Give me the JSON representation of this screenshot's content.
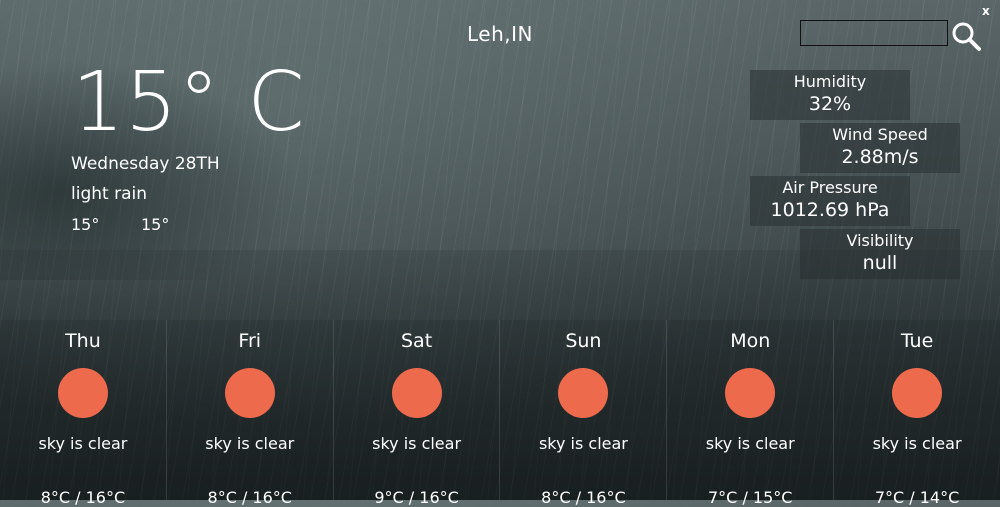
{
  "app": {
    "city": "Leh,IN",
    "search_placeholder": "",
    "close_label": "x"
  },
  "current": {
    "temperature": "15° C",
    "date": "Wednesday 28TH",
    "description": "light rain",
    "temp_min": "15°",
    "temp_max": "15°"
  },
  "stats": {
    "humidity": {
      "label": "Humidity",
      "value": "32%"
    },
    "wind_speed": {
      "label": "Wind Speed",
      "value": "2.88m/s"
    },
    "air_pressure": {
      "label": "Air Pressure",
      "value": "1012.69 hPa"
    },
    "visibility": {
      "label": "Visibility",
      "value": "null"
    }
  },
  "forecast": [
    {
      "day": "Thu",
      "condition": "sky is clear",
      "range": "8°C / 16°C",
      "icon": "sun-icon"
    },
    {
      "day": "Fri",
      "condition": "sky is clear",
      "range": "8°C / 16°C",
      "icon": "sun-icon"
    },
    {
      "day": "Sat",
      "condition": "sky is clear",
      "range": "9°C / 16°C",
      "icon": "sun-icon"
    },
    {
      "day": "Sun",
      "condition": "sky is clear",
      "range": "8°C / 16°C",
      "icon": "sun-icon"
    },
    {
      "day": "Mon",
      "condition": "sky is clear",
      "range": "7°C / 15°C",
      "icon": "sun-icon"
    },
    {
      "day": "Tue",
      "condition": "sky is clear",
      "range": "7°C / 14°C",
      "icon": "sun-icon"
    }
  ],
  "colors": {
    "sun_icon": "#ee6a4c",
    "stat_box": "#283032"
  }
}
